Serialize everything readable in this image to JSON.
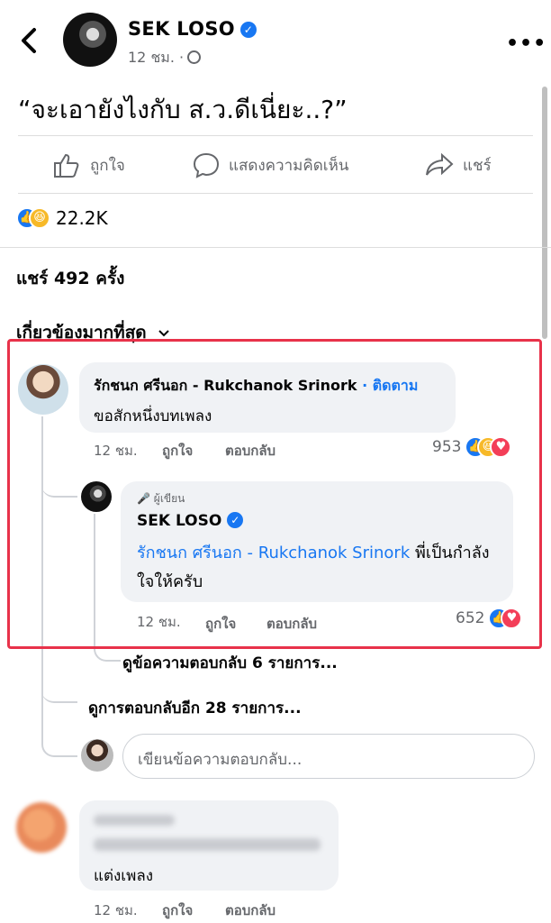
{
  "header": {
    "page_name": "SEK LOSO",
    "time": "12 ชม. ·"
  },
  "post": {
    "text": "“จะเอายังไงกับ ส.ว.ดีเนี่ยะ..?”"
  },
  "actions": {
    "like": "ถูกใจ",
    "comment": "แสดงความคิดเห็น",
    "share": "แชร์"
  },
  "stats": {
    "reactions_count": "22.2K",
    "shares": "แชร์ 492 ครั้ง"
  },
  "sort_label": "เกี่ยวข้องมากที่สุด",
  "comments": [
    {
      "name": "รักชนก ศรีนอก - Rukchanok Srinork",
      "follow": " · ติดตาม",
      "text": "ขอสักหนึ่งบทเพลง",
      "time": "12 ชม.",
      "like": "ถูกใจ",
      "reply": "ตอบกลับ",
      "reaction_count": "953"
    },
    {
      "author_badge": "ผู้เขียน",
      "name": "SEK LOSO",
      "mention": "รักชนก ศรีนอก - Rukchanok Srinork",
      "text": " พี่เป็นกำลังใจให้ครับ",
      "time": "12 ชม.",
      "like": "ถูกใจ",
      "reply": "ตอบกลับ",
      "reaction_count": "652"
    }
  ],
  "view_replies": "ดูข้อความตอบกลับ 6 รายการ...",
  "view_more_replies": "ดูการตอบกลับอีก 28 รายการ...",
  "reply_placeholder": "เขียนข้อความตอบกลับ...",
  "comment3": {
    "text": "แต่งเพลง",
    "time": "12 ชม.",
    "like": "ถูกใจ",
    "reply": "ตอบกลับ"
  }
}
